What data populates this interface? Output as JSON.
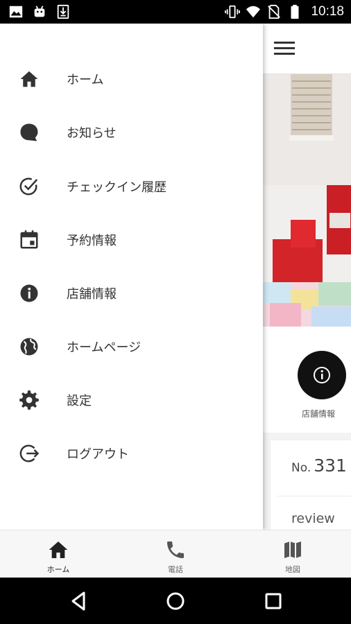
{
  "status_bar": {
    "time": "10:18",
    "left_icons": [
      "image-icon",
      "android-icon",
      "download-icon"
    ],
    "right_icons": [
      "vibrate-icon",
      "wifi-icon",
      "no-sim-icon",
      "battery-icon"
    ]
  },
  "drawer": {
    "items": [
      {
        "label": "ホーム",
        "icon": "home-icon"
      },
      {
        "label": "お知らせ",
        "icon": "chat-bubble-icon"
      },
      {
        "label": "チェックイン履歴",
        "icon": "check-circle-icon"
      },
      {
        "label": "予約情報",
        "icon": "calendar-icon"
      },
      {
        "label": "店舗情報",
        "icon": "info-icon"
      },
      {
        "label": "ホームページ",
        "icon": "globe-icon"
      },
      {
        "label": "設定",
        "icon": "gear-icon"
      },
      {
        "label": "ログアウト",
        "icon": "logout-icon"
      }
    ]
  },
  "background_screen": {
    "info_button_label": "店舗情報",
    "card": {
      "number_prefix": "No.",
      "number": "331",
      "review_label": "review"
    }
  },
  "bottom_nav": {
    "items": [
      {
        "label": "ホーム",
        "icon": "home-icon",
        "active": true
      },
      {
        "label": "電話",
        "icon": "phone-icon",
        "active": false
      },
      {
        "label": "地図",
        "icon": "map-icon",
        "active": false
      }
    ]
  },
  "system_nav": [
    "back-icon",
    "home-circle-icon",
    "recents-icon"
  ],
  "colors": {
    "status_bar": "#000000",
    "icon_dark": "#333333",
    "info_button": "#111111"
  }
}
